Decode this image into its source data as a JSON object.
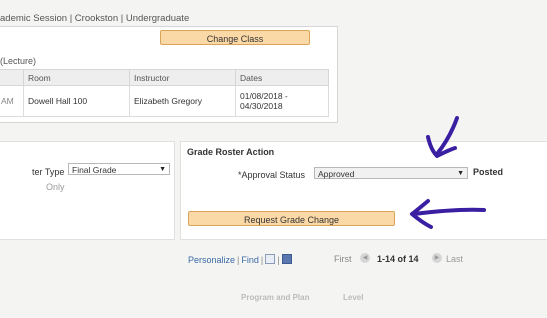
{
  "session_text": "ademic Session | Crookston | Undergraduate",
  "change_class_label": "Change Class",
  "lecture_label": "(Lecture)",
  "schedule": {
    "headers": [
      "",
      "Room",
      "Instructor",
      "Dates"
    ],
    "rows": [
      {
        "time": "AM",
        "room": "Dowell Hall 100",
        "instructor": "Elizabeth Gregory",
        "dates_1": "01/08/2018 -",
        "dates_2": "04/30/2018"
      }
    ]
  },
  "roster": {
    "type_label": "ter Type",
    "type_value": "Final Grade",
    "only_label": "Only"
  },
  "grade_roster_action": {
    "title": "Grade Roster Action",
    "approval_label": "*Approval Status",
    "approval_value": "Approved",
    "posted_label": "Posted",
    "request_button_label": "Request Grade Change"
  },
  "pager": {
    "personalize": "Personalize",
    "find": "Find",
    "first": "First",
    "count": "1-14 of 14",
    "last": "Last"
  },
  "lower_headers": {
    "program": "Program and Plan",
    "level": "Level"
  },
  "icons": {
    "select_arrow": "dropdown-arrow-icon",
    "view_all": "view-all-icon",
    "download": "download-icon",
    "prev": "previous-arrow-icon",
    "next": "next-arrow-icon"
  },
  "colors": {
    "button_bg": "#fbd9a6",
    "button_border": "#d9a45a",
    "link": "#3b6aa6",
    "annotation": "#3a1fa3"
  }
}
